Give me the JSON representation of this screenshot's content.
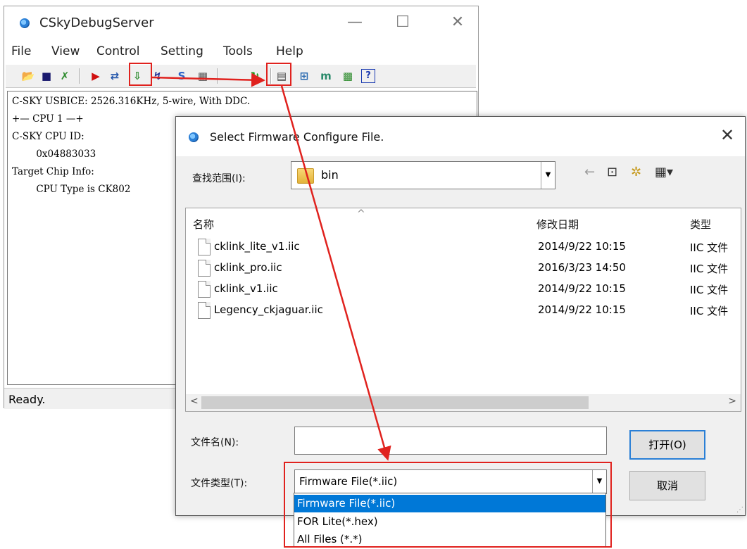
{
  "main_window": {
    "title": "CSkyDebugServer",
    "controls": {
      "minimize": "—",
      "maximize": "☐",
      "close": "✕"
    },
    "menu": [
      "File",
      "View",
      "Control",
      "Setting",
      "Tools",
      "Help"
    ],
    "console_lines": [
      "C-SKY USBICE: 2526.316KHz, 5-wire, With DDC.",
      "+— CPU 1 —+",
      "C-SKY CPU ID:",
      "        0x04883033",
      "Target Chip Info:",
      "        CPU Type is CK802"
    ],
    "status": "Ready."
  },
  "toolbar_icons": [
    {
      "name": "open-icon",
      "glyph": "📂",
      "color": "#c69a1e"
    },
    {
      "name": "save-icon",
      "glyph": "■",
      "color": "#1a1a6e"
    },
    {
      "name": "disconnect-icon",
      "glyph": "✗",
      "color": "#2e8b2e"
    },
    {
      "name": "run-icon",
      "glyph": "▶",
      "color": "#d01010"
    },
    {
      "name": "connect-icon",
      "glyph": "⇄",
      "color": "#2255aa"
    },
    {
      "name": "download-icon",
      "glyph": "⇩",
      "color": "#2e8b2e"
    },
    {
      "name": "debug-icon",
      "glyph": "↯",
      "color": "#223399"
    },
    {
      "name": "settings-s-icon",
      "glyph": "S",
      "color": "#2a62c8"
    },
    {
      "name": "chip-icon",
      "glyph": "▦",
      "color": "#555"
    },
    {
      "name": "firmware-update-icon",
      "glyph": "↻",
      "color": "#1a9a1a"
    },
    {
      "name": "register-icon",
      "glyph": "▤",
      "color": "#444"
    },
    {
      "name": "trace-icon",
      "glyph": "⊞",
      "color": "#2a6ab0"
    },
    {
      "name": "memory-icon",
      "glyph": "m",
      "color": "#2a8a6a"
    },
    {
      "name": "xml-icon",
      "glyph": "▩",
      "color": "#2a8a2a"
    },
    {
      "name": "help-icon",
      "glyph": "?",
      "color": "#1a3ab0"
    }
  ],
  "dialog": {
    "title": "Select Firmware Configure File.",
    "close": "✕",
    "lookin_label": "查找范围(I):",
    "lookin_value": "bin",
    "nav": {
      "back": "←",
      "up": "⊡",
      "new_folder": "✲",
      "view": "▦▾"
    },
    "columns": {
      "name": "名称",
      "date": "修改日期",
      "type": "类型"
    },
    "sort_arrow": "^",
    "files": [
      {
        "name": "cklink_lite_v1.iic",
        "date": "2014/9/22 10:15",
        "type": "IIC 文件"
      },
      {
        "name": "cklink_pro.iic",
        "date": "2016/3/23 14:50",
        "type": "IIC 文件"
      },
      {
        "name": "cklink_v1.iic",
        "date": "2014/9/22 10:15",
        "type": "IIC 文件"
      },
      {
        "name": "Legency_ckjaguar.iic",
        "date": "2014/9/22 10:15",
        "type": "IIC 文件"
      }
    ],
    "scroll": {
      "left": "<",
      "right": ">"
    },
    "filename_label": "文件名(N):",
    "filename_value": "",
    "filetype_label": "文件类型(T):",
    "filetype_value": "Firmware File(*.iic)",
    "open_label": "打开(O)",
    "cancel_label": "取消",
    "filetype_options": [
      "Firmware File(*.iic)",
      "FOR Lite(*.hex)",
      "All Files (*.*)"
    ],
    "selected_option": 0
  },
  "annotation_color": "#e0221e"
}
